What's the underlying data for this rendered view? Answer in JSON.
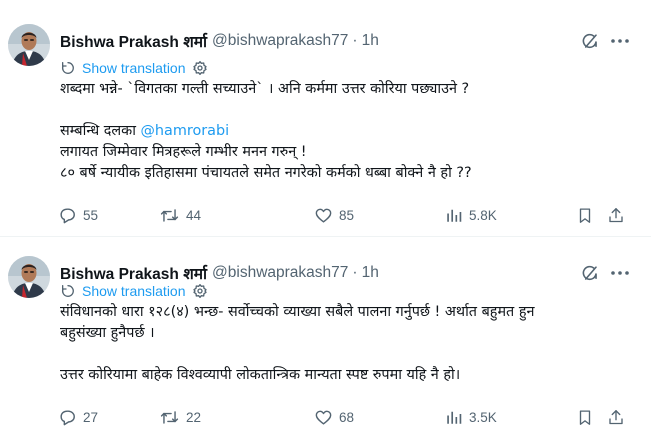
{
  "tweets": [
    {
      "author": {
        "name": "Bishwa Prakash शर्मा",
        "handle": "@bishwaprakash77",
        "separator": "·",
        "time": "1h"
      },
      "translate_label": "Show translation",
      "lines": {
        "l1": "शब्दमा भन्ने- `विगतका गल्ती सच्याउने` । अनि कर्ममा उत्तर कोरिया पछ्याउने ?",
        "l2_prefix": "सम्बन्धि दलका ",
        "l2_mention": "@hamrorabi",
        "l3": "लगायत जिम्मेवार मित्रहरूले गम्भीर मनन गरुन् !",
        "l4": "८० बर्षे न्यायीक इतिहासमा पंचायतले समेत नगरेको कर्मको धब्बा बोक्ने नै हो ??"
      },
      "stats": {
        "replies": "55",
        "reposts": "44",
        "likes": "85",
        "views": "5.8K"
      }
    },
    {
      "author": {
        "name": "Bishwa Prakash शर्मा",
        "handle": "@bishwaprakash77",
        "separator": "·",
        "time": "1h"
      },
      "translate_label": "Show translation",
      "lines": {
        "l1": "संविधानको धारा १२८(४) भन्छ- सर्वोच्चको व्याख्या सबैले पालना गर्नुपर्छ ! अर्थात बहुमत हुन",
        "l2": "बहुसंख्या हुनैपर्छ ।",
        "l3": "उत्तर कोरियामा बाहेक विश्वव्यापी लोकतान्त्रिक मान्यता स्पष्ट रुपमा यहि नै हो।"
      },
      "stats": {
        "replies": "27",
        "reposts": "22",
        "likes": "68",
        "views": "3.5K"
      }
    }
  ],
  "colors": {
    "text": "#0f1419",
    "muted": "#536471",
    "link": "#1d9bf0",
    "divider": "#eff3f4"
  }
}
